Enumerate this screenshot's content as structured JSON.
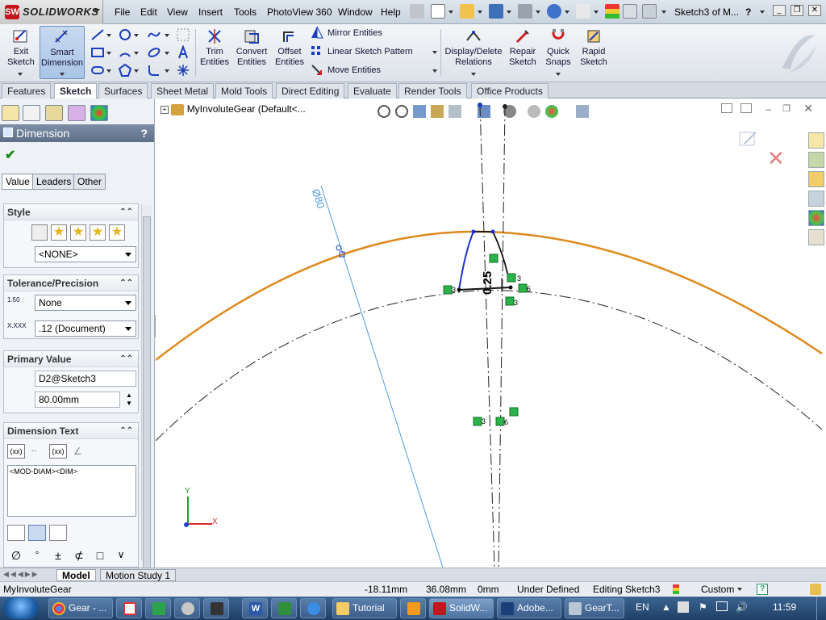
{
  "app": {
    "name": "SOLIDWORKS",
    "doc_title": "Sketch3 of M..."
  },
  "menu": [
    "File",
    "Edit",
    "View",
    "Insert",
    "Tools",
    "PhotoView 360",
    "Window",
    "Help"
  ],
  "command_manager": {
    "exit_sketch": "Exit Sketch",
    "smart_dimension": "Smart Dimension",
    "trim_entities": "Trim Entities",
    "convert_entities": "Convert Entities",
    "offset_entities": "Offset Entities",
    "mirror_entities": "Mirror Entities",
    "linear_sketch_pattern": "Linear Sketch Pattern",
    "move_entities": "Move Entities",
    "display_delete_relations": "Display/Delete Relations",
    "repair_sketch": "Repair Sketch",
    "quick_snaps": "Quick Snaps",
    "rapid_sketch": "Rapid Sketch"
  },
  "tabs": [
    "Features",
    "Sketch",
    "Surfaces",
    "Sheet Metal",
    "Mold Tools",
    "Direct Editing",
    "Evaluate",
    "Render Tools",
    "Office Products"
  ],
  "active_tab": "Sketch",
  "property_manager": {
    "title": "Dimension",
    "help": "?",
    "sub_tabs": [
      "Value",
      "Leaders",
      "Other"
    ],
    "style": {
      "header": "Style",
      "value": "<NONE>"
    },
    "tolerance": {
      "header": "Tolerance/Precision",
      "tolerance_value": "None",
      "precision_value": ".12 (Document)",
      "tol_icon_label": "1.50",
      "prec_icon_label": "X.XXX"
    },
    "primary_value": {
      "header": "Primary Value",
      "name": "D2@Sketch3",
      "value": "80.00mm"
    },
    "dimension_text": {
      "header": "Dimension Text",
      "text": "<MOD-DIAM><DIM>",
      "xx1": "(xx)",
      "xx2": "(xx)"
    }
  },
  "graphics": {
    "tree_root": "MyInvoluteGear  (Default<...",
    "diameter_label": "Ø80",
    "dim_label": "0.25",
    "relation_labels": [
      "3",
      "3",
      "3",
      "6",
      "3",
      "6"
    ],
    "axis_x": "X",
    "axis_y": "Y"
  },
  "bottom_tabs": [
    "Model",
    "Motion Study 1"
  ],
  "status": {
    "doc": "MyInvoluteGear",
    "x": "-18.11mm",
    "y": "36.08mm",
    "z": "0mm",
    "state": "Under Defined",
    "editing": "Editing Sketch3",
    "units": "Custom",
    "help": "?"
  },
  "taskbar": {
    "items": [
      "Gear - ...",
      "",
      "",
      "",
      "",
      "",
      "",
      "",
      "Tutorial",
      "",
      "SolidW...",
      "Adobe...",
      "GearT..."
    ],
    "lang": "EN",
    "clock": "11:59"
  },
  "colors": {
    "outer_circle": "#e08a1e",
    "profile": "#1a2fd1",
    "construction": "#4f9be0",
    "relation_green": "#29b34a",
    "accent": "#c4161c"
  }
}
